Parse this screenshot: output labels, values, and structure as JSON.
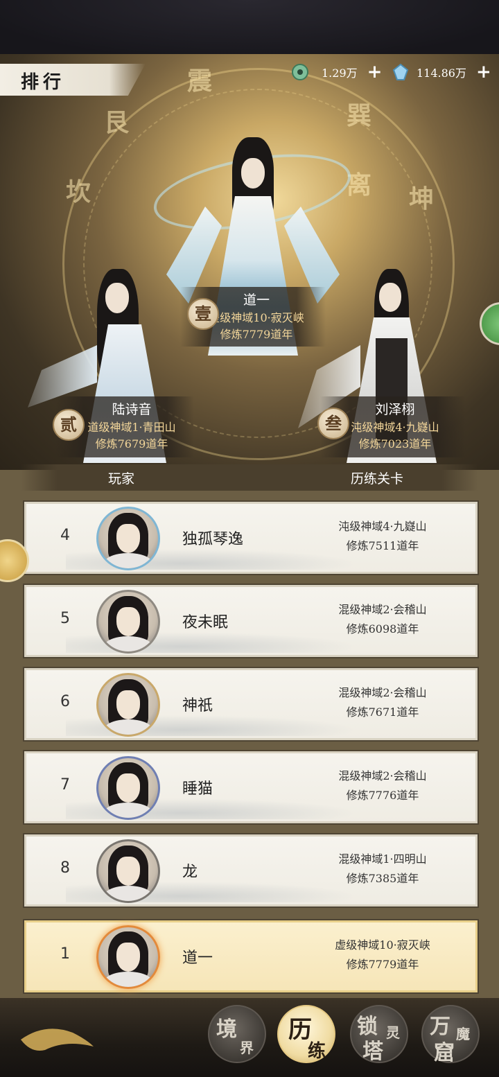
{
  "header": {
    "title": "排行",
    "currency_jade": {
      "icon": "jade-coin-icon",
      "value": "1.29万",
      "add": "+"
    },
    "currency_crystal": {
      "icon": "spirit-crystal-icon",
      "value": "114.86万",
      "add": "+"
    }
  },
  "podium": [
    {
      "rank_seal": "壹",
      "name": "道一",
      "stage": "虚级神域10·寂灭峡",
      "cultivation": "修炼7779道年"
    },
    {
      "rank_seal": "贰",
      "name": "陆诗音",
      "stage": "道级神域1·青田山",
      "cultivation": "修炼7679道年"
    },
    {
      "rank_seal": "叁",
      "name": "刘泽栩",
      "stage": "沌级神域4·九嶷山",
      "cultivation": "修炼7023道年"
    }
  ],
  "columns": {
    "player": "玩家",
    "stage": "历练关卡"
  },
  "rows": [
    {
      "rank": "4",
      "name": "独孤琴逸",
      "stage": "沌级神域4·九嶷山",
      "cultivation": "修炼7511道年"
    },
    {
      "rank": "5",
      "name": "夜未眠",
      "stage": "混级神域2·会稽山",
      "cultivation": "修炼6098道年"
    },
    {
      "rank": "6",
      "name": "神祇",
      "stage": "混级神域2·会稽山",
      "cultivation": "修炼7671道年"
    },
    {
      "rank": "7",
      "name": "睡猫",
      "stage": "混级神域2·会稽山",
      "cultivation": "修炼7776道年"
    },
    {
      "rank": "8",
      "name": "龙",
      "stage": "混级神域1·四明山",
      "cultivation": "修炼7385道年"
    }
  ],
  "my_row": {
    "rank": "1",
    "name": "道一",
    "stage": "虚级神域10·寂灭峡",
    "cultivation": "修炼7779道年"
  },
  "nav": [
    {
      "c1": "境",
      "c2": "界",
      "active": false
    },
    {
      "c1": "历",
      "c2": "练",
      "active": true
    },
    {
      "c1": "锁",
      "c2": "灵",
      "c3": "塔",
      "active": false
    },
    {
      "c1": "万",
      "c2": "魔",
      "c3": "窟",
      "active": false
    }
  ],
  "colors": {
    "gold_text": "#f4d79a",
    "active_row": "#f6e5b7",
    "panel": "#6b5e44"
  }
}
